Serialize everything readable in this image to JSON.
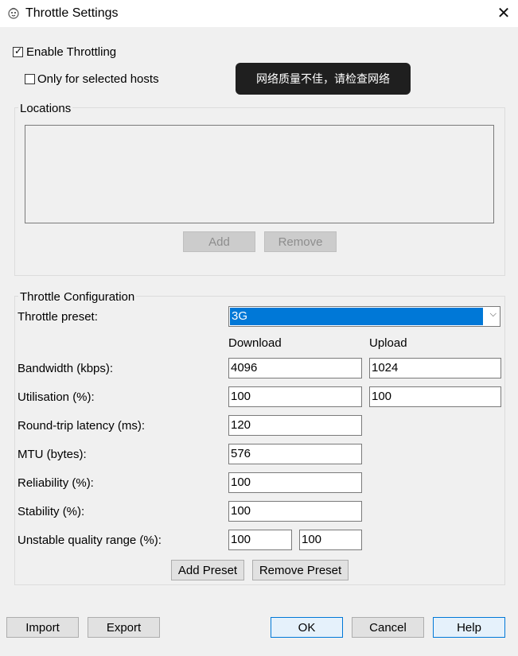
{
  "window": {
    "title": "Throttle Settings",
    "close_glyph": "✕"
  },
  "options": {
    "enable_throttling": {
      "label": "Enable Throttling",
      "checked": true
    },
    "only_selected_hosts": {
      "label": "Only for selected hosts",
      "checked": false
    }
  },
  "tooltip": {
    "text": "网络质量不佳，请检查网络"
  },
  "locations": {
    "legend": "Locations",
    "items": [],
    "add_label": "Add",
    "remove_label": "Remove"
  },
  "config": {
    "legend": "Throttle Configuration",
    "preset_label": "Throttle preset:",
    "preset_value": "3G",
    "download_header": "Download",
    "upload_header": "Upload",
    "rows": {
      "bandwidth": {
        "label": "Bandwidth (kbps):",
        "download": "4096",
        "upload": "1024"
      },
      "utilisation": {
        "label": "Utilisation (%):",
        "download": "100",
        "upload": "100"
      },
      "latency": {
        "label": "Round-trip latency (ms):",
        "value": "120"
      },
      "mtu": {
        "label": "MTU (bytes):",
        "value": "576"
      },
      "reliability": {
        "label": "Reliability (%):",
        "value": "100"
      },
      "stability": {
        "label": "Stability (%):",
        "value": "100"
      },
      "unstable_range": {
        "label": "Unstable quality range (%):",
        "min": "100",
        "max": "100"
      }
    },
    "add_preset_label": "Add Preset",
    "remove_preset_label": "Remove Preset"
  },
  "footer": {
    "import_label": "Import",
    "export_label": "Export",
    "ok_label": "OK",
    "cancel_label": "Cancel",
    "help_label": "Help"
  },
  "colors": {
    "selection": "#0078d7",
    "tooltip_bg": "#1f1f1f",
    "dialog_bg": "#f0f0f0"
  }
}
